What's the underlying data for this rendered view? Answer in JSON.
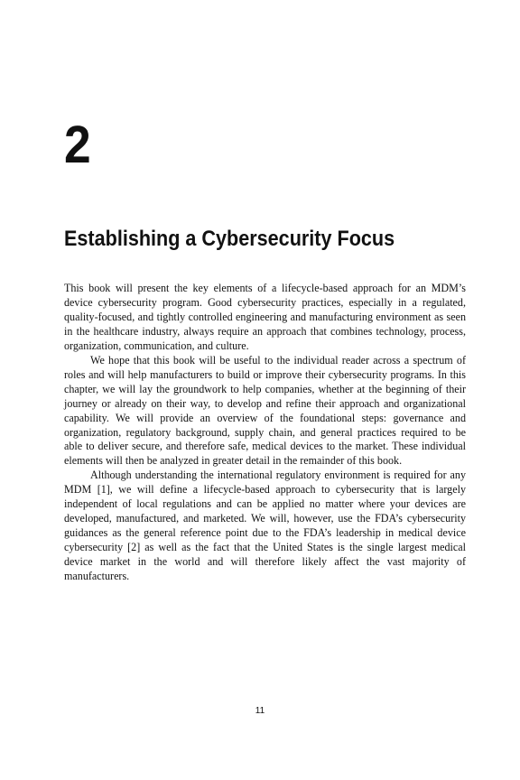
{
  "chapter": {
    "number": "2",
    "title": "Establishing a Cybersecurity Focus"
  },
  "paragraphs": [
    "This book will present the key elements of a lifecycle-based approach for an MDM’s device cybersecurity program. Good cybersecurity practices, especially in a regulated, quality-focused, and tightly controlled engineering and manufacturing environment as seen in the healthcare industry, always require an approach that combines technology, process, organization, communication, and culture.",
    "We hope that this book will be useful to the individual reader across a spectrum of roles and will help manufacturers to build or improve their cybersecurity programs. In this chapter, we will lay the groundwork to help companies, whether at the beginning of their journey or already on their way, to develop and refine their approach and organizational capability. We will provide an overview of the foundational steps: governance and organization, regulatory background, supply chain, and general practices required to be able to deliver secure, and therefore safe, medical devices to the market. These individual elements will then be analyzed in greater detail in the remainder of this book.",
    "Although understanding the international regulatory environment is required for any MDM [1], we will define a lifecycle-based approach to cybersecurity that is largely independent of local regulations and can be applied no matter where your devices are developed, manufactured, and marketed. We will, however, use the FDA’s cybersecurity guidances as the general reference point due to the FDA’s leadership in medical device cybersecurity [2] as well as the fact that the United States is the single largest medical device market in the world and will therefore likely affect the vast majority of manufacturers."
  ],
  "page_number": "11"
}
